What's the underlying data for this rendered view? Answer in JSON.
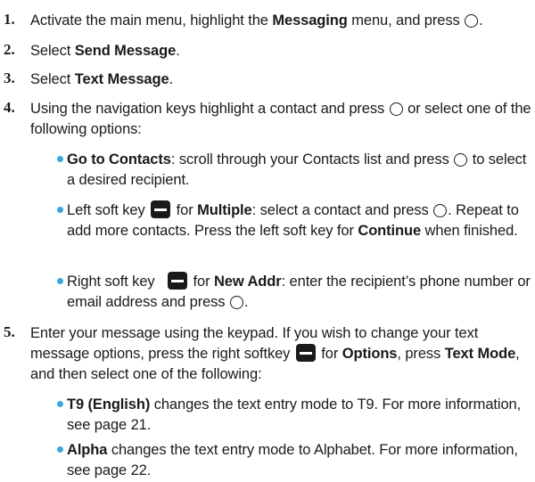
{
  "steps": [
    {
      "num": "1.",
      "a": "Activate the main menu, highlight the ",
      "b": "Messaging",
      "c": " menu, and press "
    },
    {
      "num": "2.",
      "a": "Select ",
      "b": "Send Message",
      "c": "."
    },
    {
      "num": "3.",
      "a": "Select ",
      "b": "Text Message",
      "c": "."
    },
    {
      "num": "4.",
      "a": "Using the navigation keys highlight a contact and press ",
      "b": " or select one of the following options:"
    },
    {
      "num": "5.",
      "a": "Enter your message using the keypad. If you wish to change your text message options, press the right softkey ",
      "b": " for ",
      "c": "Options",
      "d": ", press ",
      "e": "Text Mode",
      "f": ", and then select one of the following:"
    }
  ],
  "step4_bullets": [
    {
      "b": "Go to Contacts",
      "a": ": scroll through your Contacts list and press ",
      "c": " to select a desired recipient."
    },
    {
      "a": "Left soft key ",
      "b": " for ",
      "c": "Multiple",
      "d": ": select a contact and press ",
      "e": ". Repeat to add more contacts. Press the left soft key for ",
      "f": "Continue",
      "g": " when finished."
    },
    {
      "a": "Right soft key ",
      "b": " for ",
      "c": "New Addr",
      "d": ": enter the recipient’s phone number or email address and press ",
      "e": "."
    }
  ],
  "step5_bullets": [
    {
      "b": "T9 (English)",
      "a": " changes the text entry mode to T9. For more information, see page 21."
    },
    {
      "b": "Alpha",
      "a": " changes the text entry mode to Alphabet. For more information, see page 22."
    }
  ],
  "icons": {
    "ok_key": "circle-ok-key-icon",
    "soft_key": "soft-key-icon"
  },
  "colors": {
    "bullet": "#3aa6dd",
    "text": "#1a1a1a"
  }
}
